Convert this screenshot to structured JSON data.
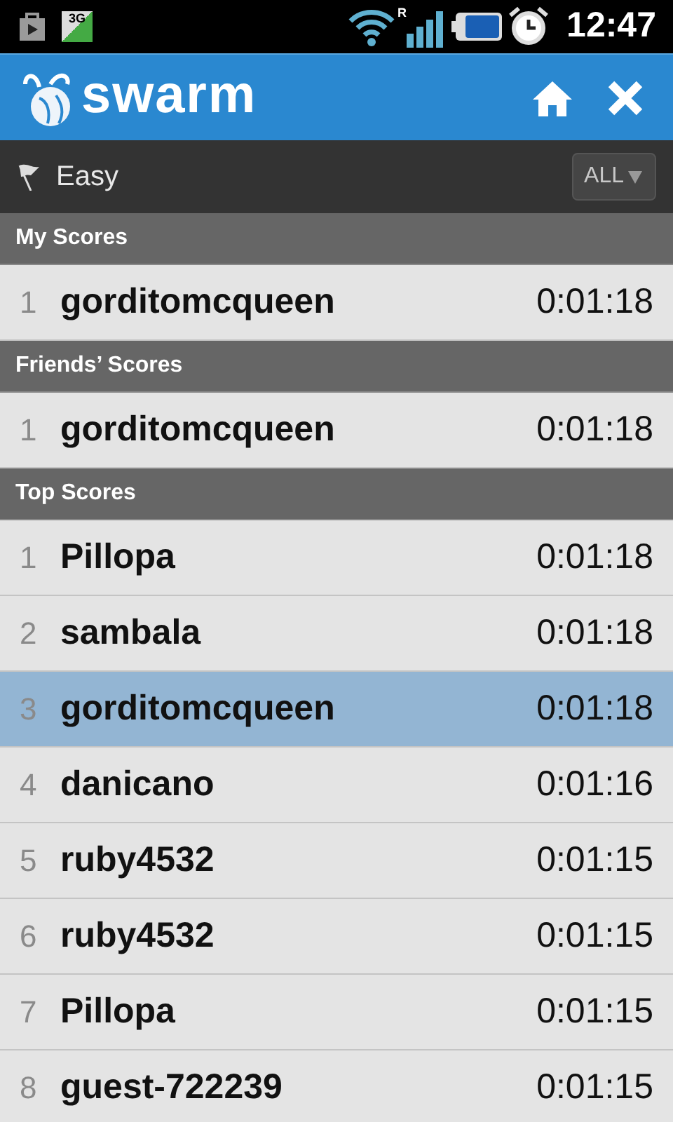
{
  "status_bar": {
    "network_badge": "3G",
    "roaming": "R",
    "time": "12:47"
  },
  "header": {
    "app_name": "swarm"
  },
  "filter_bar": {
    "difficulty": "Easy",
    "scope_button": "ALL"
  },
  "sections": [
    {
      "title": "My Scores",
      "rows": [
        {
          "rank": "1",
          "name": "gorditomcqueen",
          "time": "0:01:18",
          "selected": false
        }
      ]
    },
    {
      "title": "Friends’ Scores",
      "rows": [
        {
          "rank": "1",
          "name": "gorditomcqueen",
          "time": "0:01:18",
          "selected": false
        }
      ]
    },
    {
      "title": "Top Scores",
      "rows": [
        {
          "rank": "1",
          "name": "Pillopa",
          "time": "0:01:18",
          "selected": false
        },
        {
          "rank": "2",
          "name": "sambala",
          "time": "0:01:18",
          "selected": false
        },
        {
          "rank": "3",
          "name": "gorditomcqueen",
          "time": "0:01:18",
          "selected": true
        },
        {
          "rank": "4",
          "name": "danicano",
          "time": "0:01:16",
          "selected": false
        },
        {
          "rank": "5",
          "name": "ruby4532",
          "time": "0:01:15",
          "selected": false
        },
        {
          "rank": "6",
          "name": "ruby4532",
          "time": "0:01:15",
          "selected": false
        },
        {
          "rank": "7",
          "name": "Pillopa",
          "time": "0:01:15",
          "selected": false
        },
        {
          "rank": "8",
          "name": "guest-722239",
          "time": "0:01:15",
          "selected": false
        }
      ]
    }
  ]
}
